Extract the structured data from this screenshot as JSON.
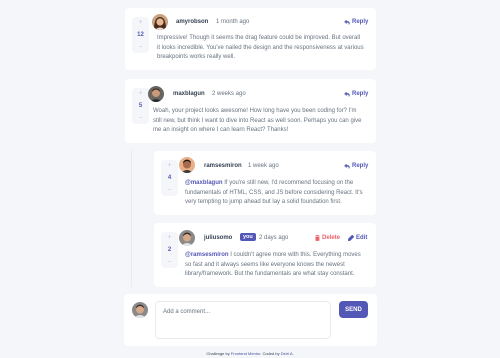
{
  "comments": [
    {
      "username": "amyrobson",
      "time": "1 month ago",
      "score": "12",
      "action": "Reply",
      "text": "Impressive! Though it seems the drag feature could be improved. But overall it looks incredible. You've nailed the design and the responsiveness at various breakpoints works really well."
    },
    {
      "username": "maxblagun",
      "time": "2 weeks ago",
      "score": "5",
      "action": "Reply",
      "text": "Woah, your project looks awesome! How long have you been coding for? I'm still new, but think I want to dive into React as well soon. Perhaps you can give me an insight on where I can learn React? Thanks!"
    }
  ],
  "replies": [
    {
      "username": "ramsesmiron",
      "time": "1 week ago",
      "score": "4",
      "action": "Reply",
      "mention": "@maxblagun",
      "text": "If you're still new, I'd recommend focusing on the fundamentals of HTML, CSS, and JS before considering React. It's very tempting to jump ahead but lay a solid foundation first."
    },
    {
      "username": "juliusomo",
      "you_badge": "you",
      "time": "2 days ago",
      "score": "2",
      "delete_label": "Delete",
      "edit_label": "Edit",
      "mention": "@ramsesmiron",
      "text": "I couldn't agree more with this. Everything moves so fast and it always seems like everyone knows the newest library/framework. But the fundamentals are what stay constant."
    }
  ],
  "new_comment": {
    "placeholder": "Add a comment...",
    "send_label": "SEND"
  },
  "attribution": {
    "prefix": "Challenge by",
    "link1": "Frontend Mentor",
    "middle": ". Coded by",
    "link2": "Deiri A",
    "suffix": "."
  },
  "colors": {
    "accent": "#5357b6",
    "danger": "#ed6368",
    "background": "#f5f6fa"
  }
}
